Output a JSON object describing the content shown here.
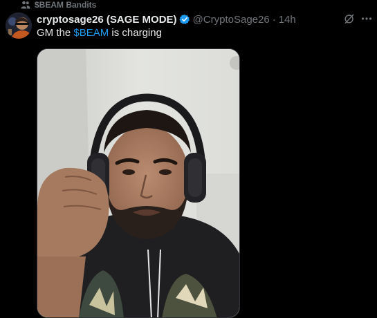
{
  "social_context": {
    "icon": "people-icon",
    "label": "$BEAM Bandits"
  },
  "tweet": {
    "avatar_icon": "avatar",
    "display_name": "cryptosage26 (SAGE MODE)",
    "verified_icon": "verified-badge-icon",
    "verified_color": "#1d9bf0",
    "handle": "@CryptoSage26",
    "separator": "·",
    "time": "14h",
    "text_before": "GM the ",
    "cashtag": "$BEAM",
    "text_after": " is charging",
    "cashtag_color": "#1d9bf0",
    "actions": {
      "grok_icon": "grok-icon",
      "more_icon": "more-icon"
    },
    "media": {
      "type": "photo"
    }
  }
}
